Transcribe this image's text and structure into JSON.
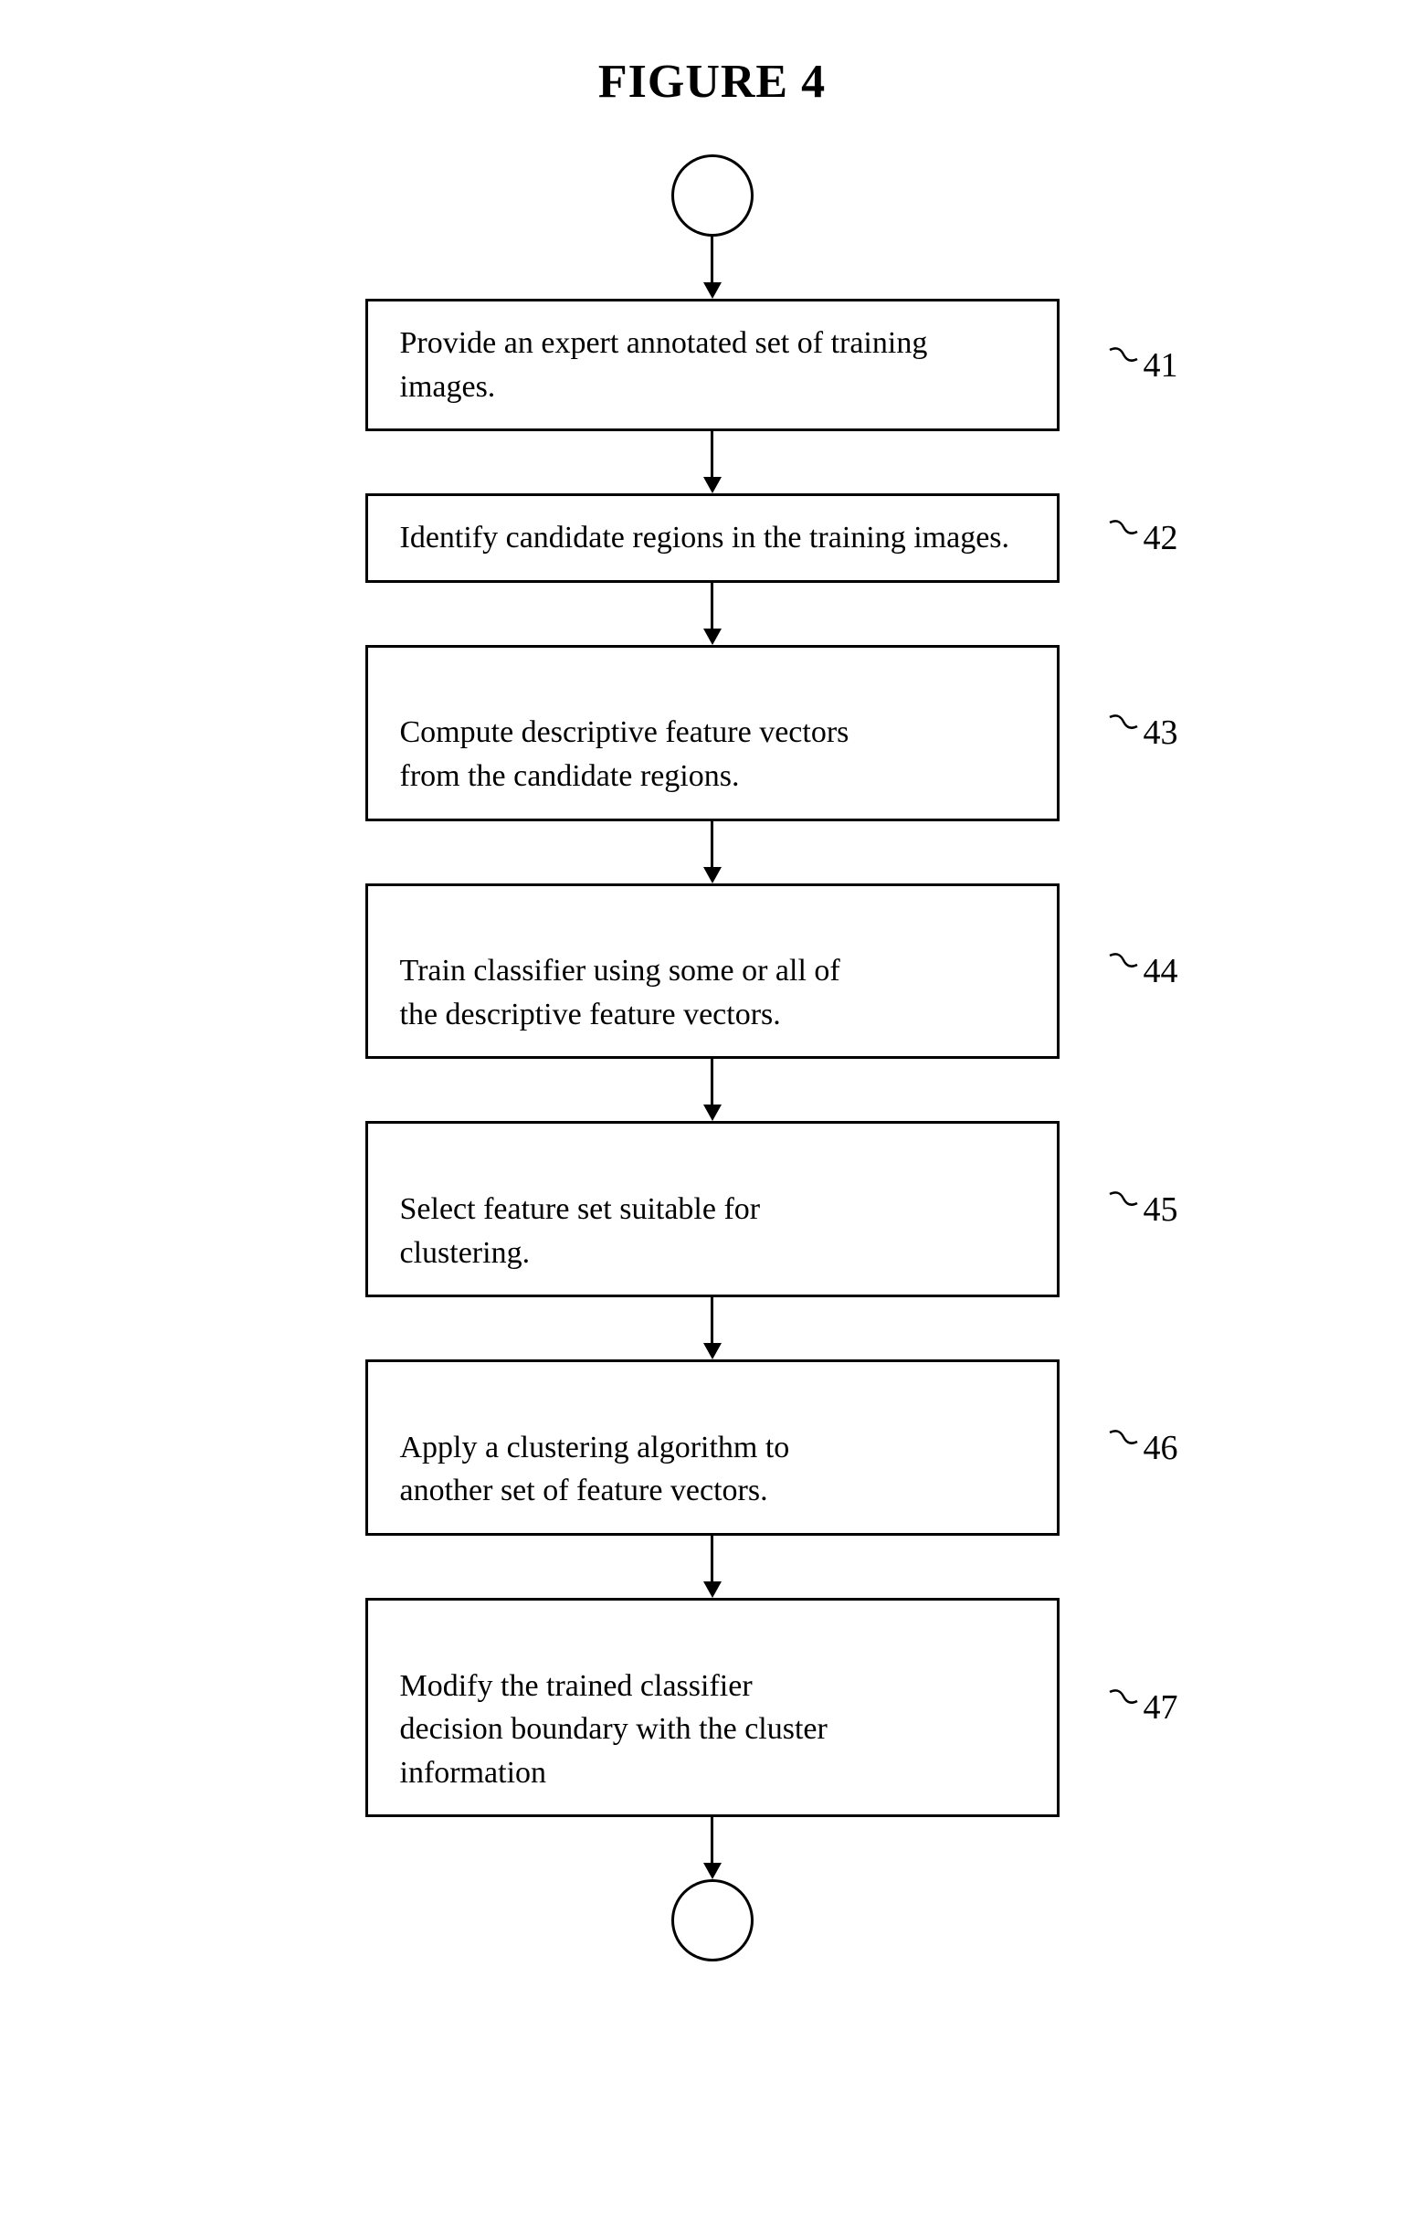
{
  "title": "FIGURE 4",
  "nodes": [
    {
      "id": "start",
      "type": "terminal"
    },
    {
      "id": "box41",
      "type": "process",
      "text": "Provide an expert annotated set of training images.",
      "label": "41"
    },
    {
      "id": "box42",
      "type": "process",
      "text": "Identify candidate regions in the training images.",
      "label": "42"
    },
    {
      "id": "box43",
      "type": "process",
      "text": "Compute descriptive feature vectors\nfrom the candidate regions.",
      "label": "43"
    },
    {
      "id": "box44",
      "type": "process",
      "text": "Train classifier using some or all of\nthe descriptive feature vectors.",
      "label": "44"
    },
    {
      "id": "box45",
      "type": "process",
      "text": "Select feature set suitable for\nclustering.",
      "label": "45"
    },
    {
      "id": "box46",
      "type": "process",
      "text": "Apply a clustering algorithm to\nanother set of feature vectors.",
      "label": "46"
    },
    {
      "id": "box47",
      "type": "process",
      "text": "Modify the trained classifier\ndecision boundary with the cluster\ninformation",
      "label": "47"
    },
    {
      "id": "end",
      "type": "terminal"
    }
  ]
}
